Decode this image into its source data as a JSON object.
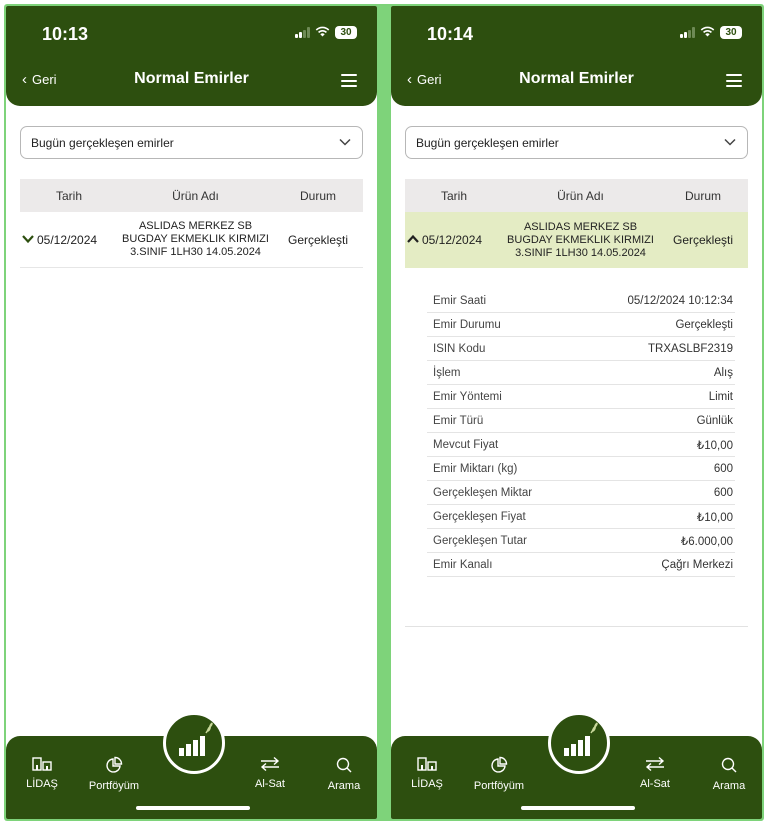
{
  "screens": [
    {
      "status_time": "10:13",
      "battery": "30",
      "back_label": "Geri",
      "title": "Normal Emirler",
      "filter_value": "Bugün gerçekleşen emirler",
      "columns": [
        "Tarih",
        "Ürün Adı",
        "Durum"
      ],
      "order": {
        "date": "05/12/2024",
        "product": "ASLIDAS MERKEZ SB BUGDAY EKMEKLIK KIRMIZI 3.SINIF 1LH30 14.05.2024",
        "status": "Gerçekleşti",
        "expanded": false
      },
      "tabs": [
        "LİDAŞ",
        "Portföyüm",
        "Al-Sat",
        "Arama"
      ]
    },
    {
      "status_time": "10:14",
      "battery": "30",
      "back_label": "Geri",
      "title": "Normal Emirler",
      "filter_value": "Bugün gerçekleşen emirler",
      "columns": [
        "Tarih",
        "Ürün Adı",
        "Durum"
      ],
      "order": {
        "date": "05/12/2024",
        "product": "ASLIDAS MERKEZ SB BUGDAY EKMEKLIK KIRMIZI 3.SINIF 1LH30 14.05.2024",
        "status": "Gerçekleşti",
        "expanded": true
      },
      "details": [
        {
          "label": "Emir Saati",
          "value": "05/12/2024 10:12:34"
        },
        {
          "label": "Emir Durumu",
          "value": "Gerçekleşti"
        },
        {
          "label": "ISIN Kodu",
          "value": "TRXASLBF2319"
        },
        {
          "label": "İşlem",
          "value": "Alış"
        },
        {
          "label": "Emir Yöntemi",
          "value": "Limit"
        },
        {
          "label": "Emir Türü",
          "value": "Günlük"
        },
        {
          "label": "Mevcut Fiyat",
          "value": "₺10,00"
        },
        {
          "label": "Emir Miktarı (kg)",
          "value": "600"
        },
        {
          "label": "Gerçekleşen Miktar",
          "value": "600"
        },
        {
          "label": "Gerçekleşen Fiyat",
          "value": "₺10,00"
        },
        {
          "label": "Gerçekleşen Tutar",
          "value": "₺6.000,00"
        },
        {
          "label": "Emir Kanalı",
          "value": "Çağrı Merkezi"
        }
      ],
      "tabs": [
        "LİDAŞ",
        "Portföyüm",
        "Al-Sat",
        "Arama"
      ]
    }
  ],
  "colors": {
    "brand": "#2d4f0f",
    "row_highlight": "#e4ecc4",
    "frame": "#7ed37a"
  }
}
